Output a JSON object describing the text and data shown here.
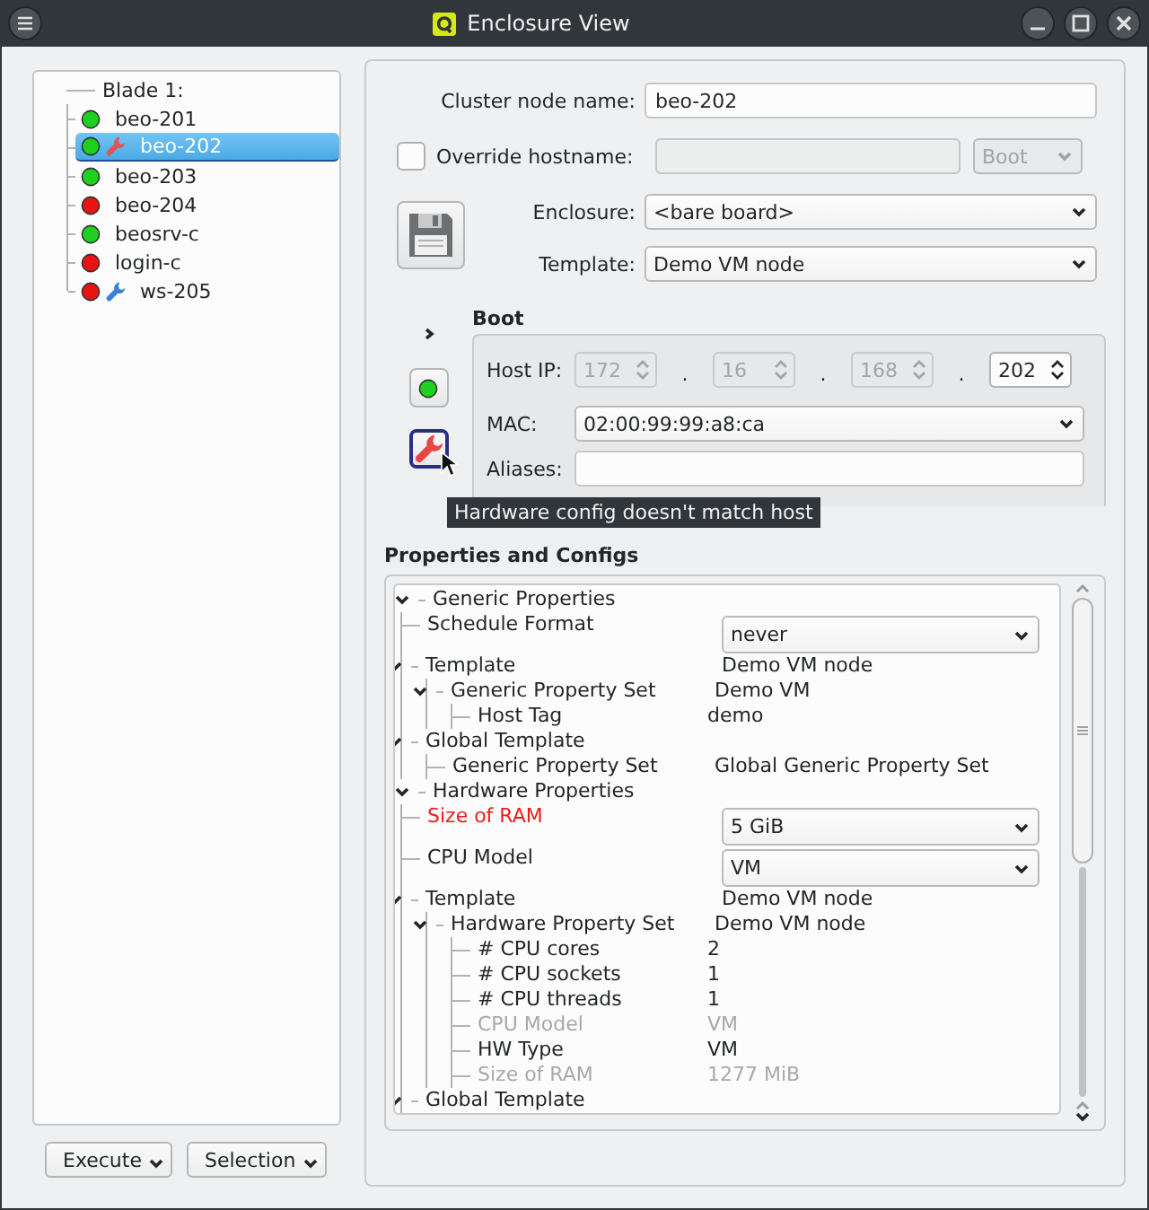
{
  "window": {
    "title": "Enclosure View"
  },
  "node_tree": {
    "root": "Blade 1:",
    "items": [
      {
        "name": "beo-201",
        "color": "#1fd11f",
        "selected": false
      },
      {
        "name": "beo-202",
        "color": "#1fd11f",
        "selected": true,
        "badges": [
          {
            "kind": "wrench",
            "color": "#e05555"
          }
        ]
      },
      {
        "name": "beo-203",
        "color": "#1fd11f",
        "selected": false
      },
      {
        "name": "beo-204",
        "color": "#e81414",
        "selected": false
      },
      {
        "name": "beosrv-c",
        "color": "#1fd11f",
        "selected": false
      },
      {
        "name": "login-c",
        "color": "#e81414",
        "selected": false
      },
      {
        "name": "ws-205",
        "color": "#e81414",
        "selected": false,
        "badges": [
          {
            "kind": "wrench",
            "color": "#3a7fd8"
          }
        ]
      }
    ]
  },
  "actions": [
    {
      "label": "Execute"
    },
    {
      "label": "Selection"
    }
  ],
  "form": {
    "cluster_node_name": {
      "label": "Cluster node name:",
      "value": "beo-202"
    },
    "override_hostname": {
      "label": "Override hostname:",
      "checked": false
    },
    "boot_mode": {
      "value": "Boot",
      "disabled": true
    },
    "enclosure": {
      "label": "Enclosure:",
      "value": "<bare board>"
    },
    "template": {
      "label": "Template:",
      "value": "Demo VM node"
    }
  },
  "boot": {
    "title": "Boot",
    "expanded": false,
    "status": {
      "color": "#1fd11f"
    },
    "host_ip": {
      "label": "Host IP:",
      "separators": [
        ".",
        ".",
        "."
      ],
      "parts": [
        {
          "value": "172",
          "disabled": true
        },
        {
          "value": "16",
          "disabled": true
        },
        {
          "value": "168",
          "disabled": true
        },
        {
          "value": "202",
          "disabled": false
        }
      ]
    },
    "mac": {
      "label": "MAC:",
      "value": "02:00:99:99:a8:ca"
    },
    "aliases": {
      "label": "Aliases:"
    },
    "tooltip": "Hardware config doesn't match host"
  },
  "properties": {
    "title": "Properties and Configs",
    "rows": [
      {
        "label": "Generic Properties",
        "expanded": true,
        "children": [
          {
            "label": "Schedule Format",
            "kind": "select",
            "value": "never"
          },
          {
            "label": "Template",
            "kind": "text",
            "value": "Demo VM node",
            "expanded": true,
            "children": [
              {
                "label": "Generic Property Set",
                "kind": "text",
                "value": "Demo VM",
                "expanded": true,
                "children": [
                  {
                    "label": "Host Tag",
                    "kind": "text",
                    "value": "demo"
                  }
                ]
              }
            ]
          },
          {
            "label": "Global Template",
            "expanded": true,
            "children": [
              {
                "label": "Generic Property Set",
                "kind": "text",
                "value": "Global Generic Property Set"
              }
            ]
          }
        ]
      },
      {
        "label": "Hardware Properties",
        "expanded": true,
        "children": [
          {
            "label": "Size of RAM",
            "kind": "select",
            "value": "5 GiB",
            "changed": true
          },
          {
            "label": "CPU Model",
            "kind": "select",
            "value": "VM",
            "changed": false
          },
          {
            "label": "Template",
            "kind": "text",
            "value": "Demo VM node",
            "expanded": true,
            "changed": false,
            "children": [
              {
                "label": "Hardware Property Set",
                "kind": "text",
                "value": "Demo VM node",
                "expanded": true,
                "children": [
                  {
                    "label": "# CPU cores",
                    "kind": "text",
                    "value": "2",
                    "disabled": false
                  },
                  {
                    "label": "# CPU sockets",
                    "kind": "text",
                    "value": "1",
                    "disabled": false
                  },
                  {
                    "label": "# CPU threads",
                    "kind": "text",
                    "value": "1",
                    "disabled": false
                  },
                  {
                    "label": "CPU Model",
                    "kind": "text",
                    "value": "VM",
                    "disabled": true
                  },
                  {
                    "label": "HW Type",
                    "kind": "text",
                    "value": "VM",
                    "disabled": false
                  },
                  {
                    "label": "Size of RAM",
                    "kind": "text",
                    "value": "1277 MiB",
                    "disabled": true
                  }
                ]
              }
            ]
          },
          {
            "label": "Global Template",
            "expanded": true,
            "changed": false
          }
        ]
      }
    ]
  }
}
